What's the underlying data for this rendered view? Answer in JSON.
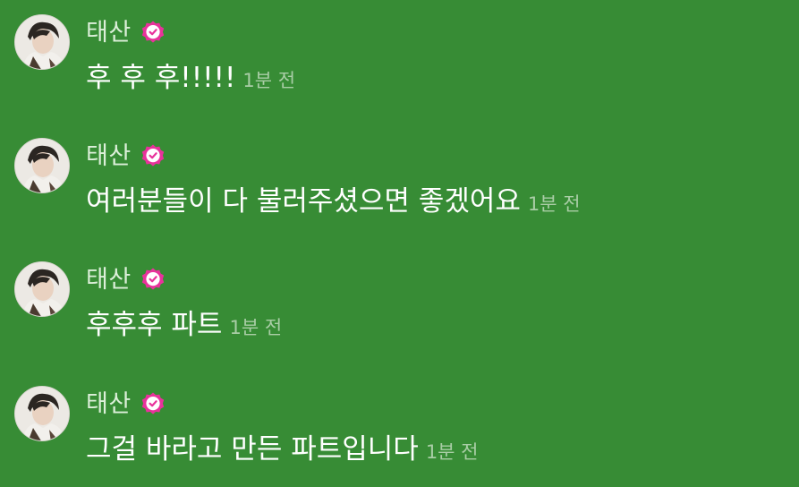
{
  "colors": {
    "background": "#378c35",
    "name_text": "#dcefd9",
    "message_text": "#ffffff",
    "timestamp_text": "#a9cda6",
    "verified_badge": "#e8329b"
  },
  "messages": [
    {
      "author": "태산",
      "verified_icon": "verified-badge-icon",
      "text": "후 후 후!!!!!",
      "time": "1분 전"
    },
    {
      "author": "태산",
      "verified_icon": "verified-badge-icon",
      "text": "여러분들이 다 불러주셨으면 좋겠어요",
      "time": "1분 전"
    },
    {
      "author": "태산",
      "verified_icon": "verified-badge-icon",
      "text": "후후후 파트",
      "time": "1분 전"
    },
    {
      "author": "태산",
      "verified_icon": "verified-badge-icon",
      "text": "그걸 바라고 만든 파트입니다",
      "time": "1분 전"
    }
  ]
}
